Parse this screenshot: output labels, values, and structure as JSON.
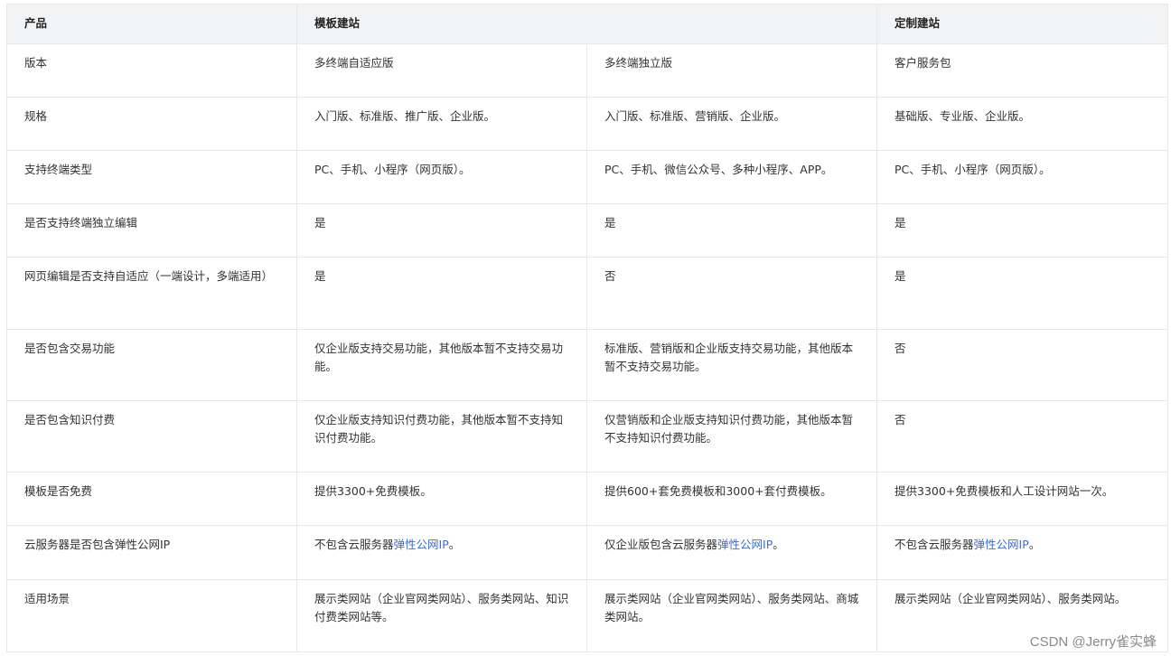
{
  "header": [
    "产品",
    "模板建站",
    "定制建站"
  ],
  "rows": [
    {
      "label": "版本",
      "cells": [
        {
          "text": "多终端自适应版"
        },
        {
          "text": "多终端独立版"
        },
        {
          "text": "客户服务包"
        }
      ]
    },
    {
      "label": "规格",
      "cells": [
        {
          "text": "入门版、标准版、推广版、企业版。"
        },
        {
          "text": "入门版、标准版、营销版、企业版。"
        },
        {
          "text": "基础版、专业版、企业版。"
        }
      ]
    },
    {
      "label": "支持终端类型",
      "cells": [
        {
          "text": "PC、手机、小程序（网页版）。"
        },
        {
          "text": "PC、手机、微信公众号、多种小程序、APP。"
        },
        {
          "text": "PC、手机、小程序（网页版）。"
        }
      ]
    },
    {
      "label": "是否支持终端独立编辑",
      "cells": [
        {
          "text": "是"
        },
        {
          "text": "是"
        },
        {
          "text": "是"
        }
      ]
    },
    {
      "label": "网页编辑是否支持自适应（一端设计，多端适用）",
      "cells": [
        {
          "text": "是"
        },
        {
          "text": "否"
        },
        {
          "text": "是"
        }
      ]
    },
    {
      "label": "是否包含交易功能",
      "cells": [
        {
          "text": "仅企业版支持交易功能，其他版本暂不支持交易功能。"
        },
        {
          "text": "标准版、营销版和企业版支持交易功能，其他版本暂不支持交易功能。"
        },
        {
          "text": "否"
        }
      ]
    },
    {
      "label": "是否包含知识付费",
      "cells": [
        {
          "text": "仅企业版支持知识付费功能，其他版本暂不支持知识付费功能。"
        },
        {
          "text": "仅营销版和企业版支持知识付费功能，其他版本暂不支持知识付费功能。"
        },
        {
          "text": "否"
        }
      ]
    },
    {
      "label": "模板是否免费",
      "cells": [
        {
          "text": "提供3300+免费模板。"
        },
        {
          "text": "提供600+套免费模板和3000+套付费模板。"
        },
        {
          "text": "提供3300+免费模板和人工设计网站一次。"
        }
      ]
    },
    {
      "label": "云服务器是否包含弹性公网IP",
      "cells": [
        {
          "pre": "不包含云服务器",
          "link": "弹性公网IP",
          "post": "。"
        },
        {
          "pre": "仅企业版包含云服务器",
          "link": "弹性公网IP",
          "post": "。"
        },
        {
          "pre": "不包含云服务器",
          "link": "弹性公网IP",
          "post": "。"
        }
      ]
    },
    {
      "label": "适用场景",
      "cells": [
        {
          "text": "展示类网站（企业官网类网站）、服务类网站、知识付费类网站等。"
        },
        {
          "text": "展示类网站（企业官网类网站）、服务类网站、商城类网站。"
        },
        {
          "text": "展示类网站（企业官网类网站）、服务类网站。"
        }
      ]
    }
  ],
  "watermark": "CSDN @Jerry雀实蜂"
}
